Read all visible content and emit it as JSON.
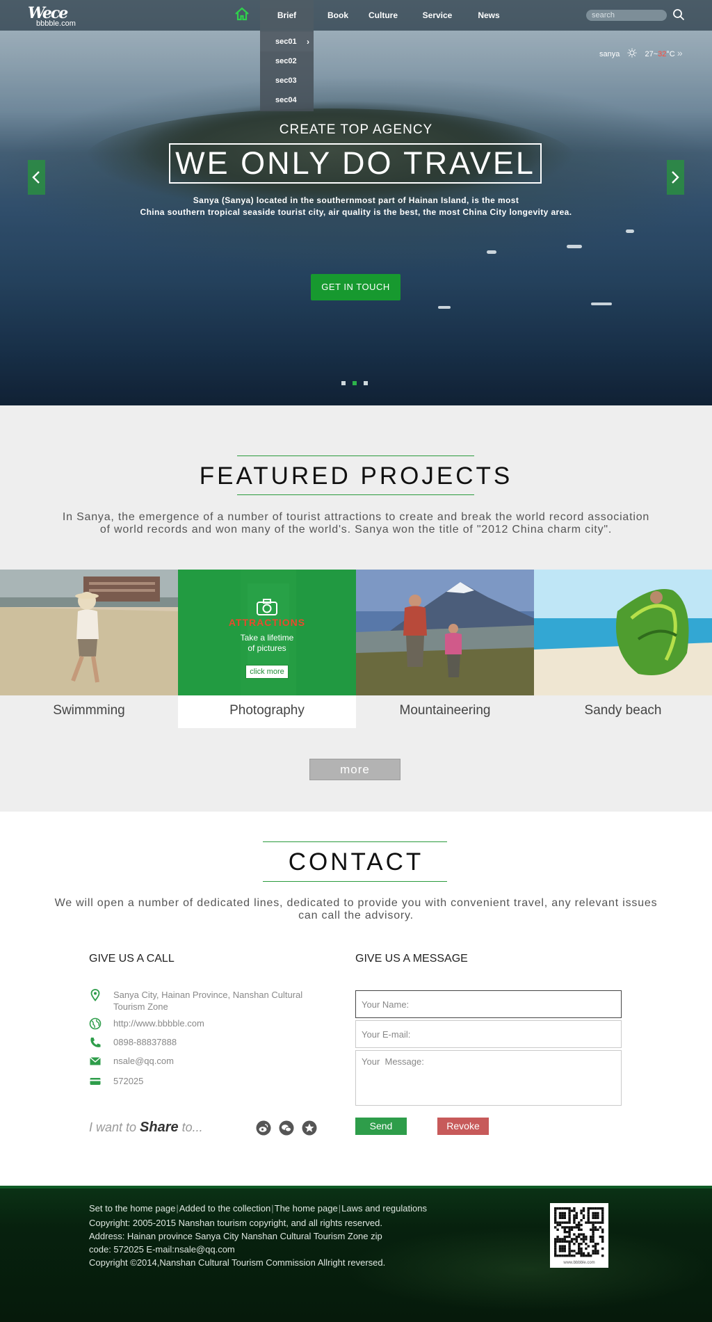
{
  "header": {
    "logo_mark": "Wece",
    "logo_text": "bbbble.com",
    "nav": [
      "Brief",
      "Book",
      "Culture",
      "Service",
      "News"
    ],
    "dropdown": [
      "sec01",
      "sec02",
      "sec03",
      "sec04"
    ],
    "search_placeholder": "search",
    "weather": {
      "city": "sanya",
      "low": "27~",
      "high": "32",
      "unit": "°C",
      "more": "»"
    }
  },
  "hero": {
    "subtitle": "CREATE TOP AGENCY",
    "title": "WE ONLY DO TRAVEL",
    "desc_line1": "Sanya (Sanya) located in the southernmost part of Hainan Island, is the most",
    "desc_line2": "China southern tropical seaside tourist city, air quality is the best, the most China City longevity area.",
    "cta": "GET IN TOUCH",
    "slides": 3,
    "active_slide": 2
  },
  "featured": {
    "title": "FEATURED PROJECTS",
    "desc_line1": "In Sanya, the emergence of a number of tourist attractions to create and break the world record association",
    "desc_line2": "of world records and won many of the world's. Sanya won the title of \"2012 China charm city\".",
    "cards": [
      "Swimmming",
      "Photography",
      "Mountaineering",
      "Sandy beach"
    ],
    "overlay": {
      "title": "ATTRACTIONS",
      "text_line1": "Take a lifetime",
      "text_line2": "of pictures",
      "button": "click more"
    },
    "more": "more"
  },
  "contact": {
    "title": "CONTACT",
    "desc_line1": "We will open a number of dedicated lines, dedicated to provide you with convenient travel, any relevant issues",
    "desc_line2": "can call the advisory.",
    "call_title": "GIVE US A CALL",
    "message_title": "GIVE US A MESSAGE",
    "address_line1": "Sanya City, Hainan Province, Nanshan Cultural",
    "address_line2": "Tourism Zone",
    "website": "http://www.bbbble.com",
    "phone": "0898-88837888",
    "email": "nsale@qq.com",
    "zip": "572025",
    "name_placeholder": "Your Name:",
    "email_placeholder": "Your E-mail:",
    "message_placeholder": "Your  Message:",
    "send": "Send",
    "revoke": "Revoke",
    "share_pre": "I want to ",
    "share_word": "Share",
    "share_post": " to..."
  },
  "footer": {
    "links": [
      "Set to the home page",
      "Added to the collection",
      "The home page",
      "Laws and regulations"
    ],
    "line1": "Copyright: 2005-2015 Nanshan tourism copyright, and all rights reserved.",
    "line2": "Address: Hainan province Sanya City Nanshan Cultural Tourism Zone zip",
    "line3": "code: 572025 E-mail:nsale@qq.com",
    "line4": "Copyright ©2014,Nanshan Cultural Tourism Commission Allright reversed.",
    "qr_caption": "www.bbbble.com"
  },
  "colors": {
    "accent": "#17992f",
    "attractions": "#e84a2c",
    "revoke": "#c75a5a",
    "hot": "#ff4a3a"
  }
}
